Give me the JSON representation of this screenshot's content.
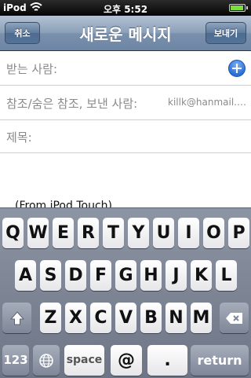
{
  "status_bar": {
    "carrier": "iPod",
    "time": "오후 5:52",
    "battery_level": 0.95
  },
  "nav": {
    "cancel": "취소",
    "title": "새로운 메시지",
    "send": "보내기"
  },
  "form": {
    "to_label": "받는 사람:",
    "cc_label": "참조/숨은 참조, 보낸 사람:",
    "cc_value": "killk@hanmail.net",
    "subject_label": "제목:"
  },
  "body": {
    "signature": "(From iPod Touch)"
  },
  "keyboard": {
    "row1": [
      "Q",
      "W",
      "E",
      "R",
      "T",
      "Y",
      "U",
      "I",
      "O",
      "P"
    ],
    "row2": [
      "A",
      "S",
      "D",
      "F",
      "G",
      "H",
      "J",
      "K",
      "L"
    ],
    "row3": [
      "Z",
      "X",
      "C",
      "V",
      "B",
      "N",
      "M"
    ],
    "numbers": "123",
    "space": "space",
    "at": "@",
    "dot": ".",
    "return": "return"
  }
}
